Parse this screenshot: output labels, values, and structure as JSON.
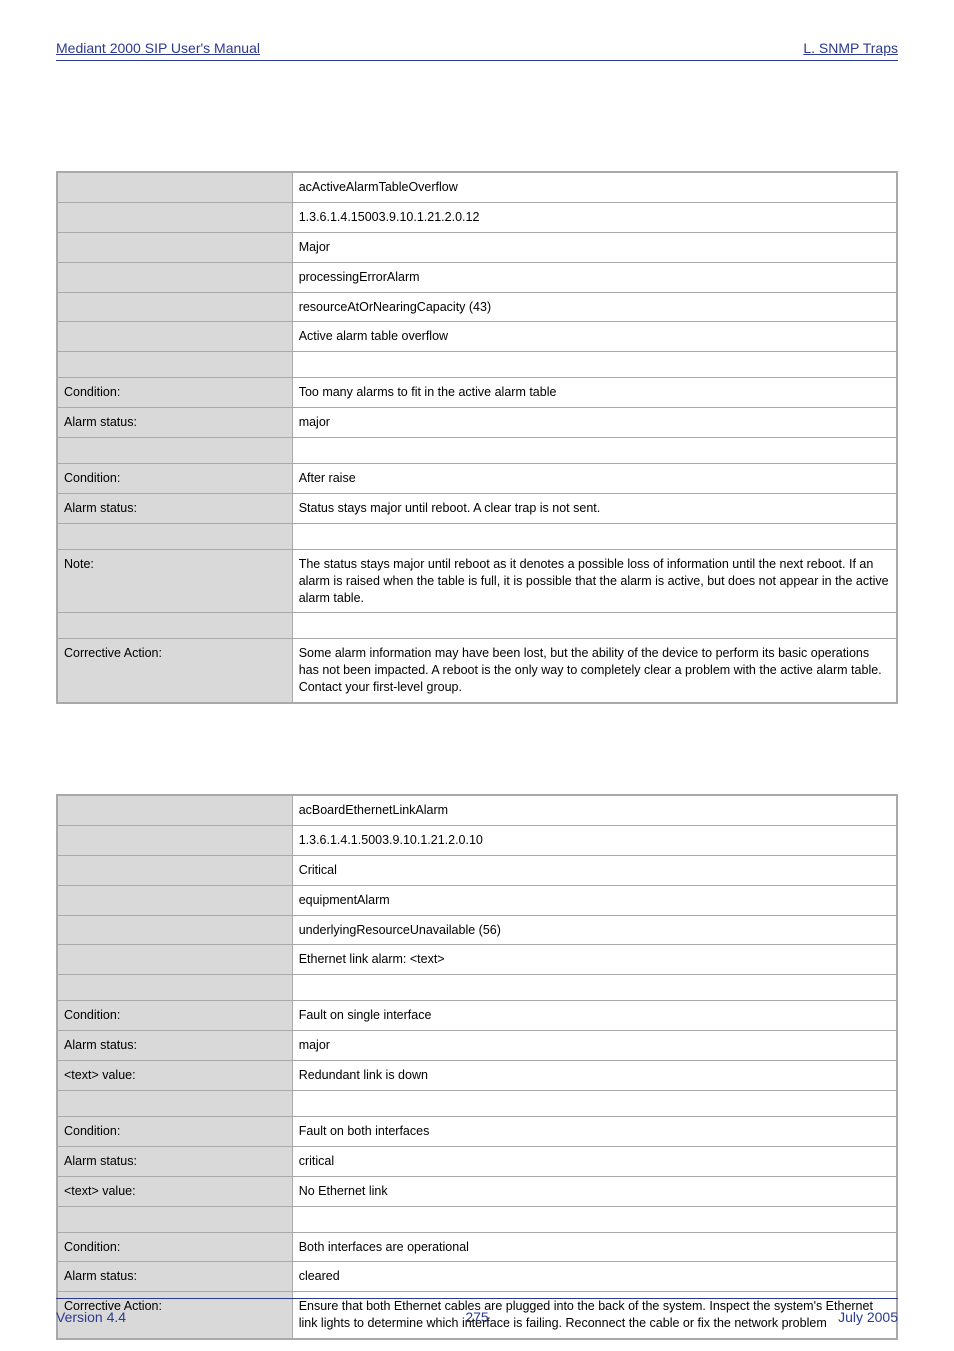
{
  "header": {
    "left": "Mediant 2000 SIP User's Manual",
    "right": "L. SNMP Traps"
  },
  "table1": {
    "rows": [
      {
        "label": "",
        "value": "acActiveAlarmTableOverflow"
      },
      {
        "label": "",
        "value": "1.3.6.1.4.15003.9.10.1.21.2.0.12"
      },
      {
        "label": "",
        "value": "Major"
      },
      {
        "label": "",
        "value": "processingErrorAlarm"
      },
      {
        "label": "",
        "value": "resourceAtOrNearingCapacity (43)"
      },
      {
        "label": "",
        "value": "Active alarm table overflow"
      },
      {
        "label": "",
        "value": ""
      },
      {
        "label": "Condition:",
        "value": "Too many alarms to fit in the active alarm table"
      },
      {
        "label": "Alarm status:",
        "value": "major"
      },
      {
        "label": "",
        "value": ""
      },
      {
        "label": "Condition:",
        "value": "After raise"
      },
      {
        "label": "Alarm status:",
        "value": "Status stays major until reboot. A clear trap is not sent."
      },
      {
        "label": "",
        "value": ""
      },
      {
        "label": "Note:",
        "value": "The status stays major until reboot as it denotes a possible loss of information until the next reboot. If an alarm is raised when the table is full, it is possible that the alarm is active, but does not appear in the active alarm table."
      },
      {
        "label": "",
        "value": ""
      },
      {
        "label": "Corrective Action:",
        "value": "Some alarm information may have been lost, but the ability of the device to perform its basic operations has not been impacted. A reboot is the only way to completely clear a problem with the active alarm table. Contact your first-level group."
      }
    ]
  },
  "table2": {
    "rows": [
      {
        "label": "",
        "value": "acBoardEthernetLinkAlarm"
      },
      {
        "label": "",
        "value": "1.3.6.1.4.1.5003.9.10.1.21.2.0.10"
      },
      {
        "label": "",
        "value": "Critical"
      },
      {
        "label": "",
        "value": "equipmentAlarm"
      },
      {
        "label": "",
        "value": "underlyingResourceUnavailable (56)"
      },
      {
        "label": "",
        "value": "Ethernet link alarm: <text>"
      },
      {
        "label": "",
        "value": ""
      },
      {
        "label": "Condition:",
        "value": "Fault on single interface"
      },
      {
        "label": "Alarm status:",
        "value": "major"
      },
      {
        "label": "<text> value:",
        "value": "Redundant link is down"
      },
      {
        "label": "",
        "value": ""
      },
      {
        "label": "Condition:",
        "value": "Fault on both interfaces"
      },
      {
        "label": "Alarm status:",
        "value": "critical"
      },
      {
        "label": "<text> value:",
        "value": "No Ethernet link"
      },
      {
        "label": "",
        "value": ""
      },
      {
        "label": "Condition:",
        "value": "Both interfaces are operational"
      },
      {
        "label": "Alarm status:",
        "value": "cleared"
      },
      {
        "label": "Corrective Action:",
        "value": "Ensure that both Ethernet cables are plugged into the back of the system. Inspect the system's Ethernet link lights to determine which interface is failing. Reconnect the cable or fix the network problem"
      }
    ]
  },
  "footer": {
    "left": "Version 4.4",
    "center": "275",
    "right": "July 2005"
  }
}
